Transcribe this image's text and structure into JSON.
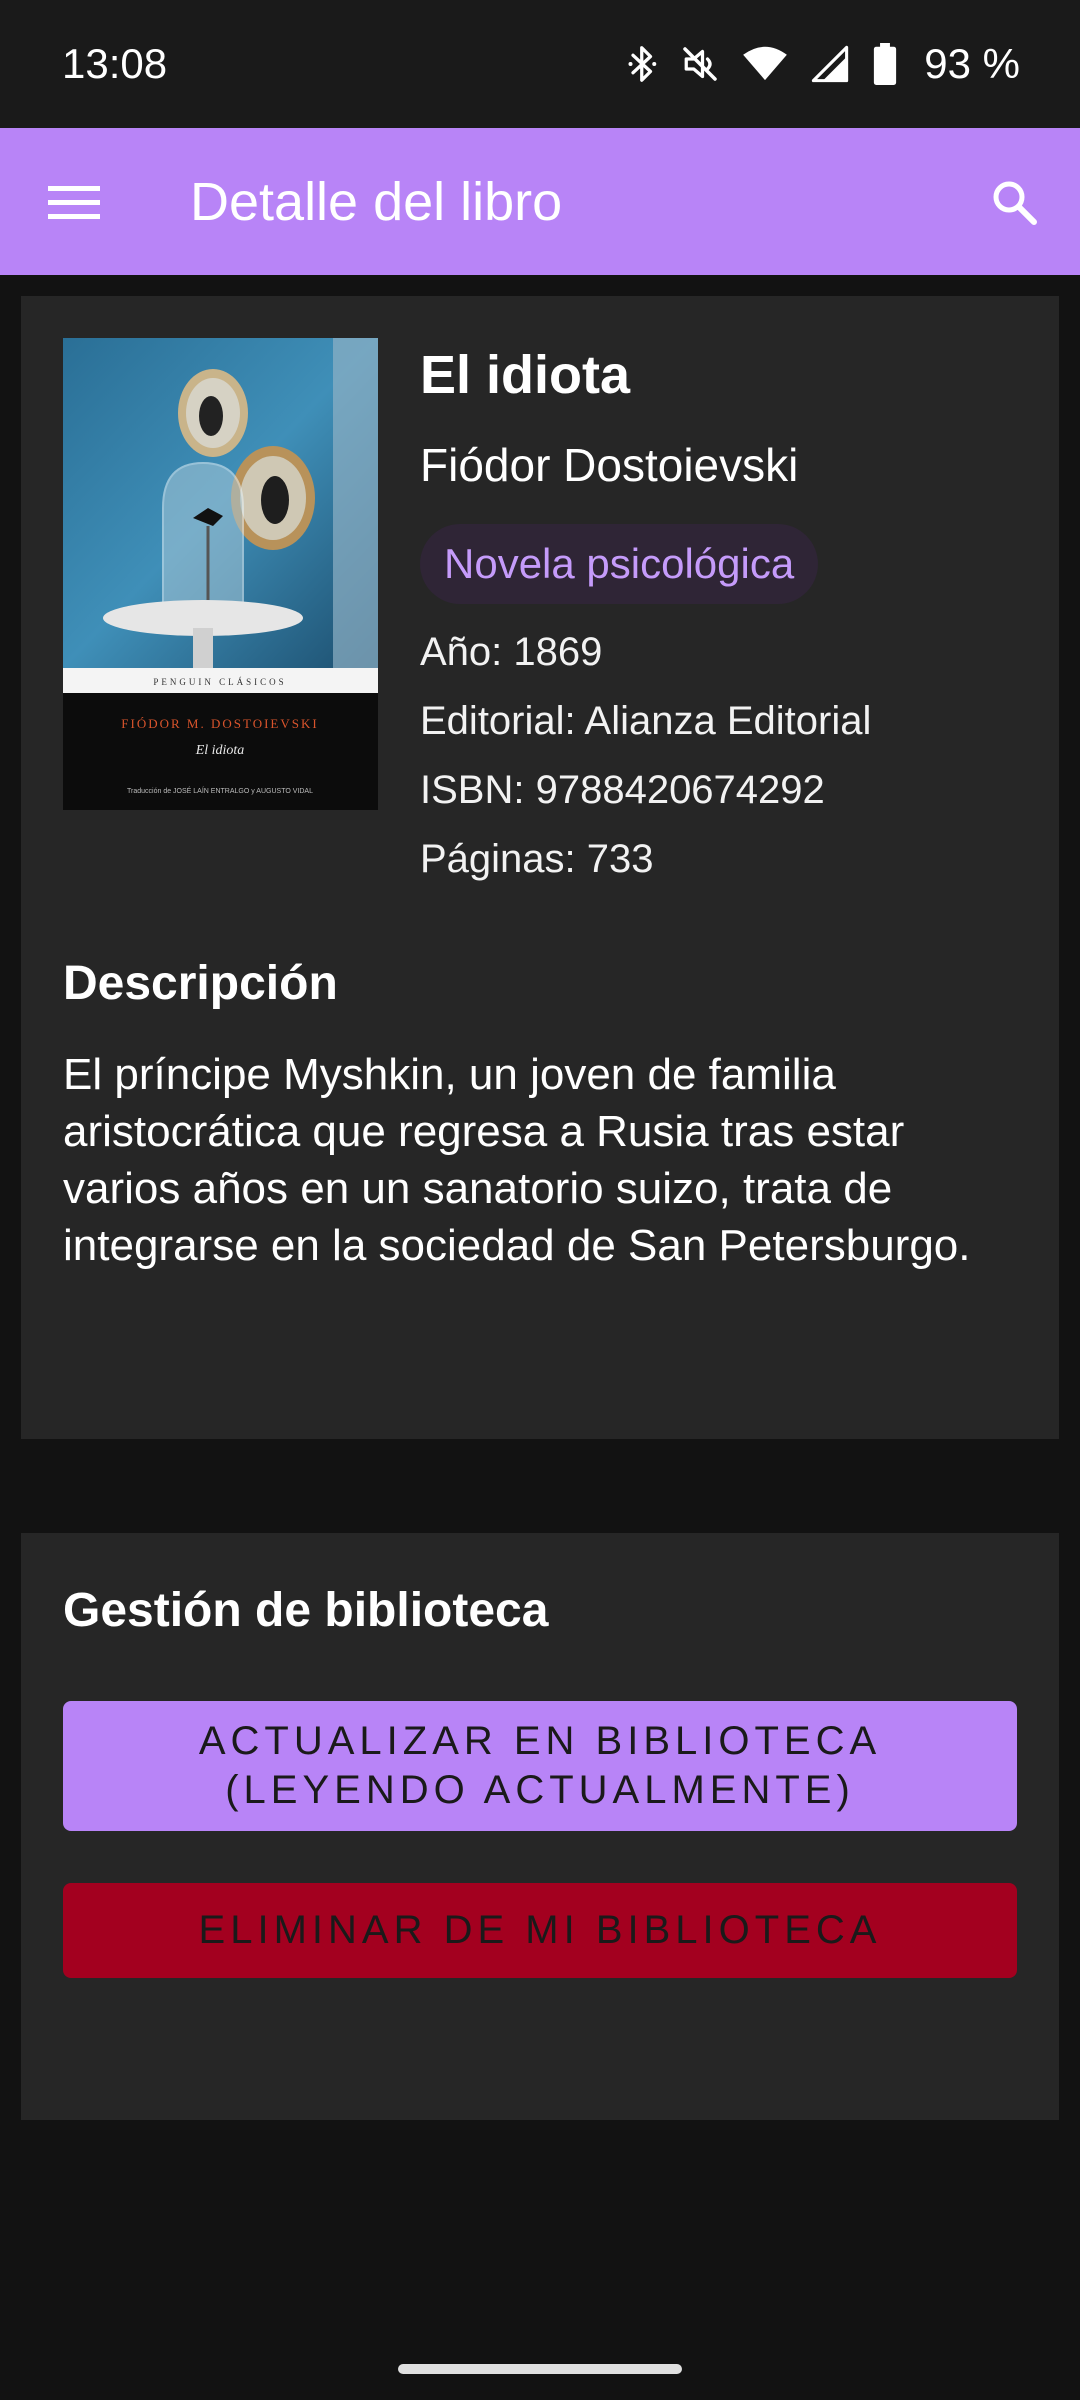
{
  "status_bar": {
    "time": "13:08",
    "battery": "93 %",
    "icons": [
      "bluetooth-icon",
      "mute-icon",
      "wifi-icon",
      "signal-icon",
      "battery-icon"
    ]
  },
  "app_bar": {
    "title": "Detalle del libro",
    "menu_icon": "menu-icon",
    "search_icon": "search-icon",
    "color": "#b884f7"
  },
  "book": {
    "title": "El idiota",
    "author": "Fiódor Dostoievski",
    "genre": "Novela psicológica",
    "year": "Año: 1869",
    "publisher": "Editorial: Alianza Editorial",
    "isbn": "ISBN: 9788420674292",
    "pages": "Páginas: 733",
    "cover": {
      "series": "PENGUIN CLÁSICOS",
      "author": "FIÓDOR M. DOSTOIEVSKI",
      "title": "El idiota",
      "credits": "Traducción de JOSÉ LAÍN ENTRALGO y AUGUSTO VIDAL"
    }
  },
  "description": {
    "heading": "Descripción",
    "text": "El príncipe Myshkin, un joven de familia aristocrática que regresa a Rusia tras estar varios años en un sanatorio suizo, trata de integrarse en la sociedad de San Petersburgo."
  },
  "management": {
    "heading": "Gestión de biblioteca",
    "update_label": "ACTUALIZAR EN BIBLIOTECA\n(LEYENDO ACTUALMENTE)",
    "delete_label": "ELIMINAR DE MI BIBLIOTECA",
    "delete_color": "#a3001f"
  }
}
